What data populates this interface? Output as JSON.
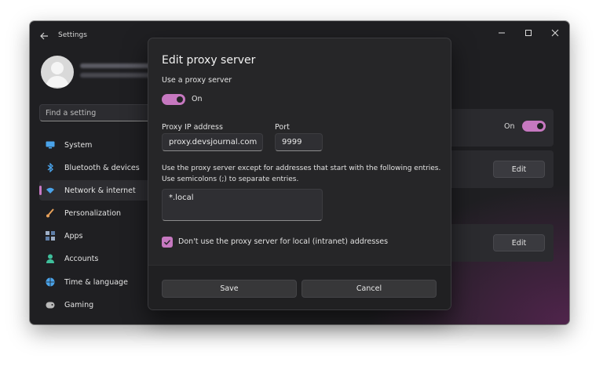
{
  "window": {
    "title": "Settings",
    "controls": [
      {
        "name": "minimize",
        "glyph": "—"
      },
      {
        "name": "maximize",
        "glyph": "☐"
      },
      {
        "name": "close",
        "glyph": "✕"
      }
    ]
  },
  "sidebar": {
    "search_placeholder": "Find a setting",
    "items": [
      {
        "label": "System",
        "icon": "monitor-icon",
        "active": false
      },
      {
        "label": "Bluetooth & devices",
        "icon": "bluetooth-icon",
        "active": false
      },
      {
        "label": "Network & internet",
        "icon": "wifi-icon",
        "active": true
      },
      {
        "label": "Personalization",
        "icon": "brush-icon",
        "active": false
      },
      {
        "label": "Apps",
        "icon": "apps-icon",
        "active": false
      },
      {
        "label": "Accounts",
        "icon": "person-icon",
        "active": false
      },
      {
        "label": "Time & language",
        "icon": "globe-icon",
        "active": false
      },
      {
        "label": "Gaming",
        "icon": "gamepad-icon",
        "active": false
      }
    ]
  },
  "background": {
    "toggle_state": "On",
    "edit_label_1": "Edit",
    "edit_label_2": "Edit"
  },
  "dialog": {
    "title": "Edit proxy server",
    "use_proxy_label": "Use a proxy server",
    "use_proxy_state": "On",
    "ip_label": "Proxy IP address",
    "ip_value": "proxy.devsjournal.com",
    "port_label": "Port",
    "port_value": "9999",
    "exceptions_help_line1": "Use the proxy server except for addresses that start with the following entries.",
    "exceptions_help_line2": "Use semicolons (;) to separate entries.",
    "exceptions_value": "*.local",
    "local_bypass_label": "Don't use the proxy server for local (intranet) addresses",
    "local_bypass_checked": true,
    "save_label": "Save",
    "cancel_label": "Cancel"
  },
  "colors": {
    "accent": "#c678c0",
    "window_bg": "#1f1f22",
    "dialog_bg": "#262628"
  }
}
